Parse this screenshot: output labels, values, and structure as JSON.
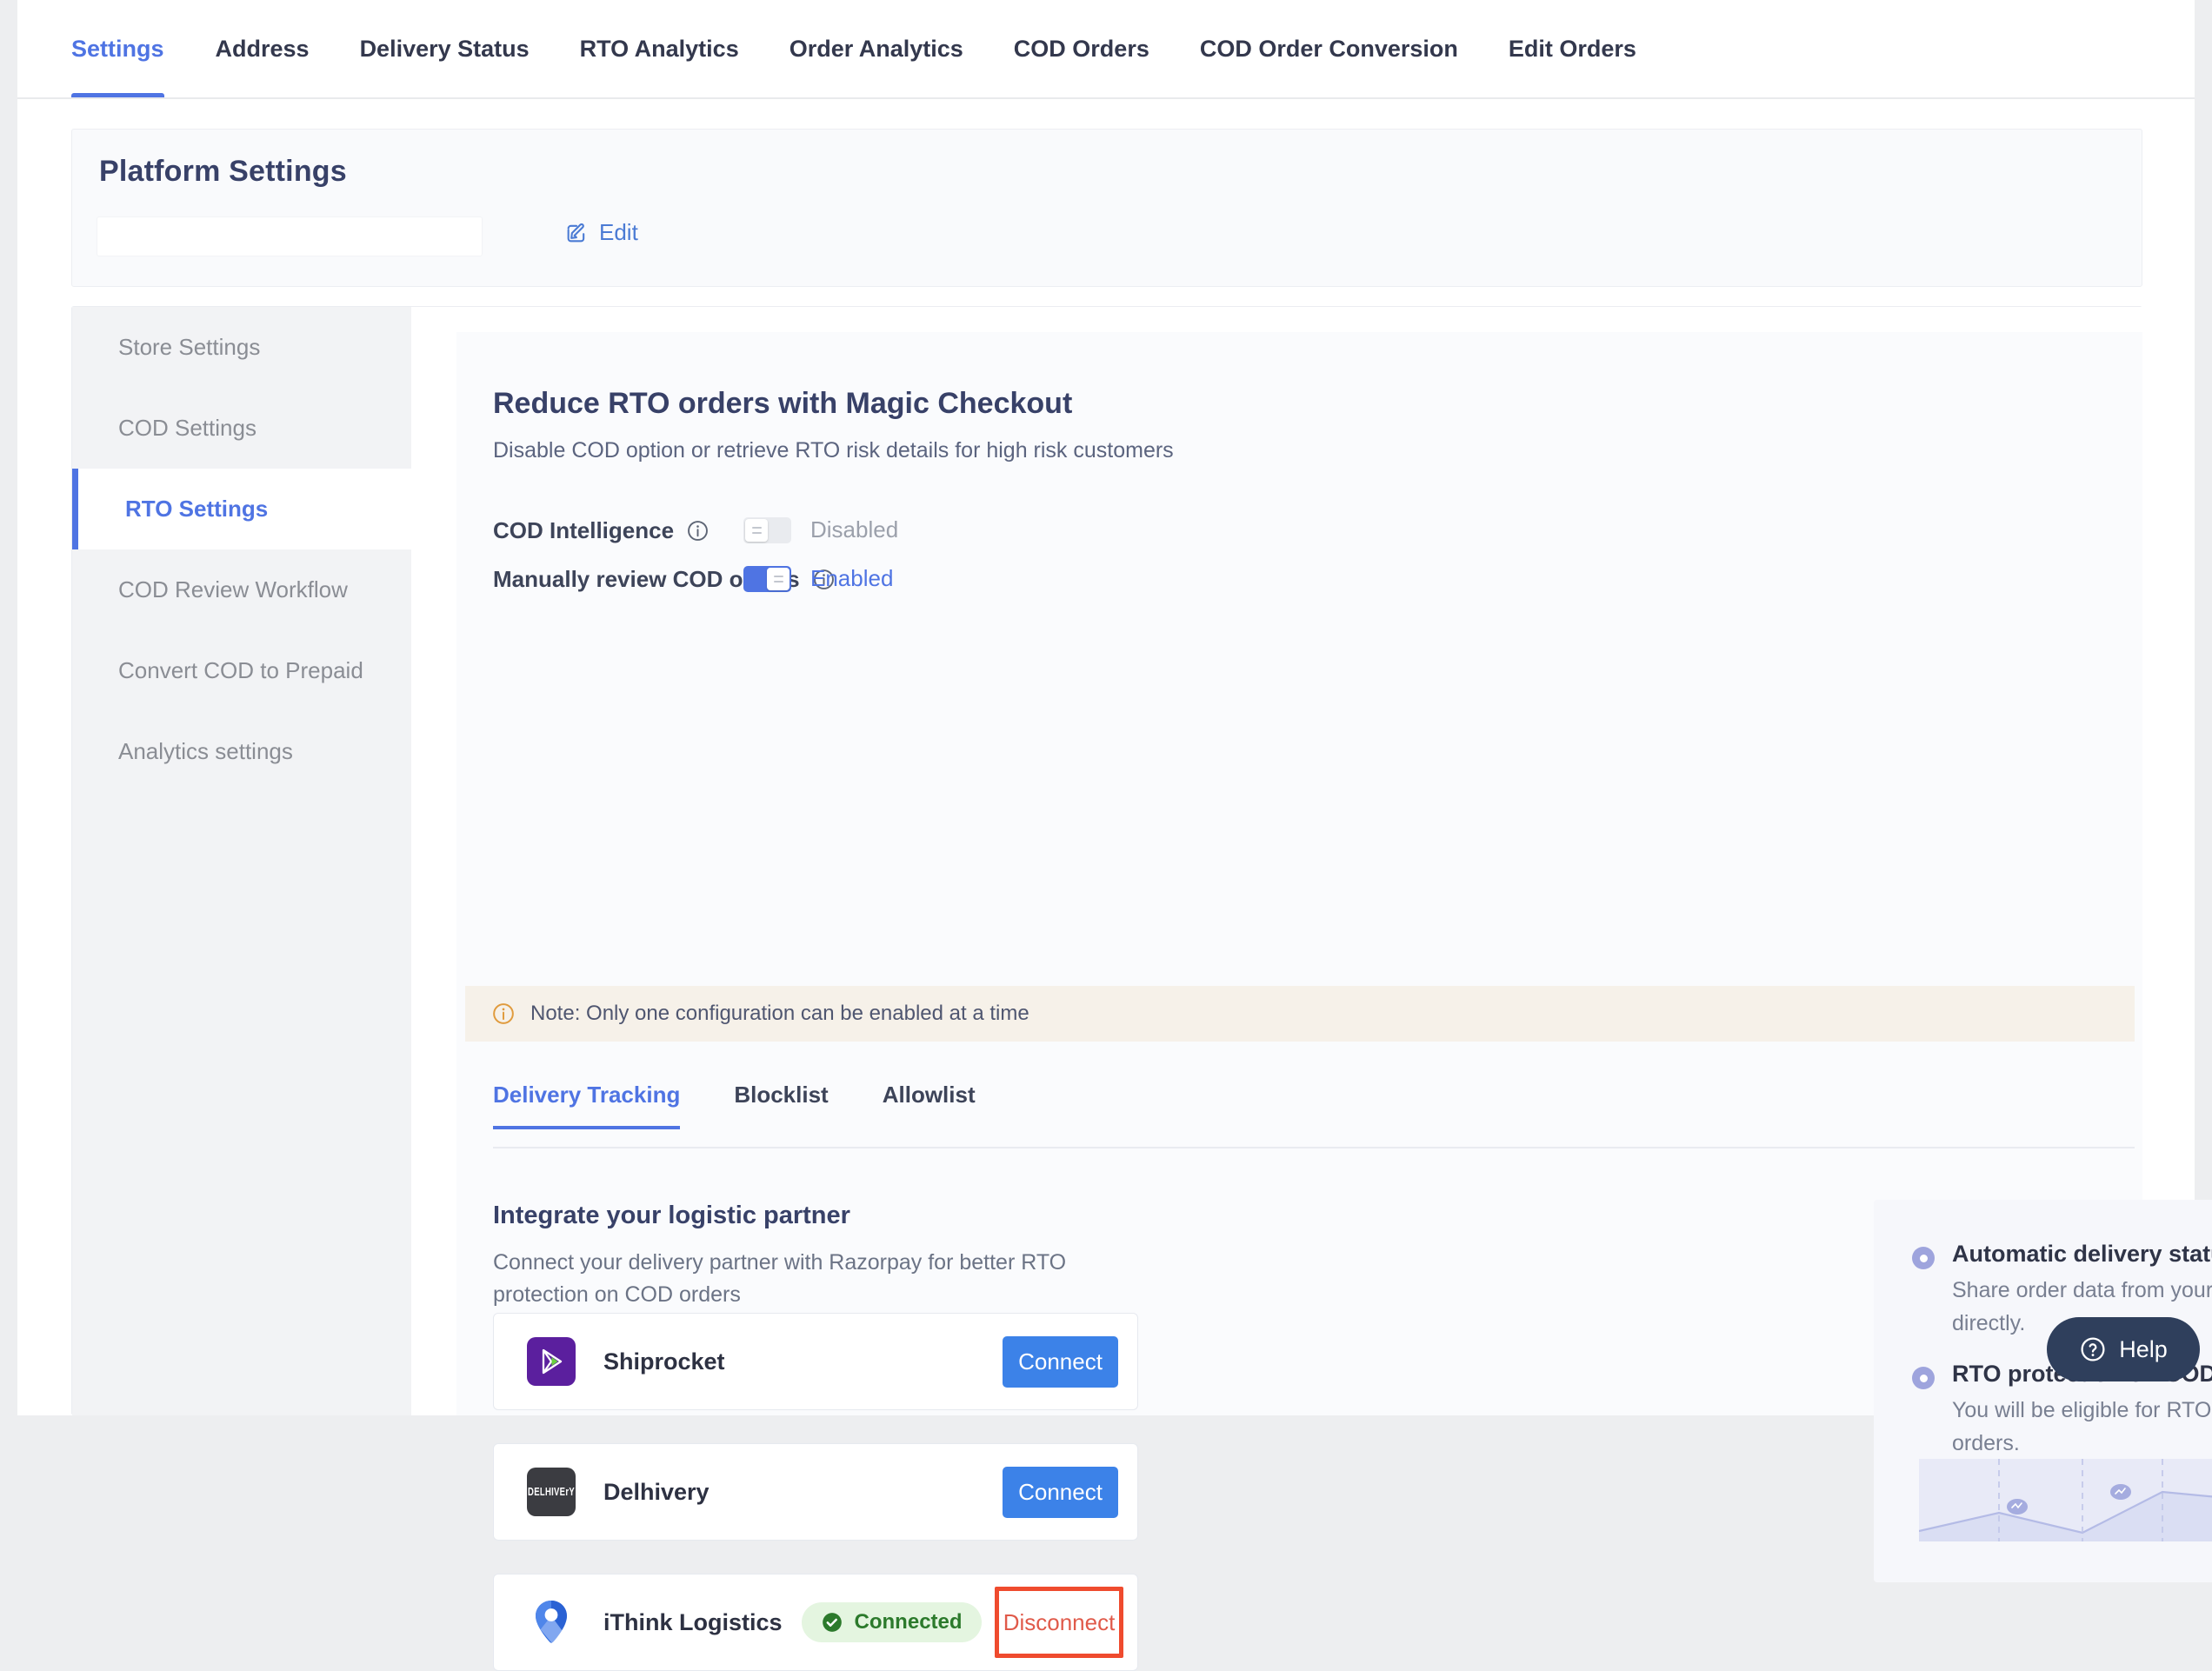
{
  "topnav": {
    "items": [
      {
        "label": "Settings",
        "active": true
      },
      {
        "label": "Address",
        "active": false
      },
      {
        "label": "Delivery Status",
        "active": false
      },
      {
        "label": "RTO Analytics",
        "active": false
      },
      {
        "label": "Order Analytics",
        "active": false
      },
      {
        "label": "COD Orders",
        "active": false
      },
      {
        "label": "COD Order Conversion",
        "active": false
      },
      {
        "label": "Edit Orders",
        "active": false
      }
    ]
  },
  "platform_settings": {
    "title": "Platform Settings",
    "input_value": "",
    "edit_label": "Edit",
    "edit_icon": "pencil-square-icon"
  },
  "sidebar": {
    "items": [
      {
        "label": "Store Settings",
        "active": false
      },
      {
        "label": "COD Settings",
        "active": false
      },
      {
        "label": "RTO Settings",
        "active": true
      },
      {
        "label": "COD Review Workflow",
        "active": false
      },
      {
        "label": "Convert COD to Prepaid",
        "active": false
      },
      {
        "label": "Analytics settings",
        "active": false
      }
    ]
  },
  "main": {
    "section_title": "Reduce RTO orders with Magic Checkout",
    "section_subtitle": "Disable COD option or retrieve RTO risk details for high risk customers",
    "settings_rows": [
      {
        "label": "COD Intelligence",
        "info_icon": "info-circle-icon",
        "state": "Disabled",
        "enabled": false
      },
      {
        "label": "Manually review COD orders",
        "info_icon": "info-circle-icon",
        "state": "Enabled",
        "enabled": true
      }
    ],
    "note": {
      "icon": "info-circle-icon",
      "text": "Note: Only one configuration can be enabled at a time"
    },
    "tabs": [
      {
        "label": "Delivery Tracking",
        "active": true
      },
      {
        "label": "Blocklist",
        "active": false
      },
      {
        "label": "Allowlist",
        "active": false
      }
    ],
    "integrate": {
      "title": "Integrate your logistic partner",
      "subtitle": "Connect your delivery partner with Razorpay for better RTO protection on COD orders"
    },
    "partners": [
      {
        "name": "Shiprocket",
        "logo": "shiprocket-logo-icon",
        "status": null,
        "action_label": "Connect",
        "action_type": "connect"
      },
      {
        "name": "Delhivery",
        "logo": "delhivery-logo-icon",
        "logo_text": "DELHIVErY",
        "status": null,
        "action_label": "Connect",
        "action_type": "connect"
      },
      {
        "name": "iThink Logistics",
        "logo": "ithink-logistics-map-pin-icon",
        "status": "Connected",
        "status_icon": "check-circle-icon",
        "action_label": "Disconnect",
        "action_type": "disconnect"
      }
    ]
  },
  "info_panel": {
    "items": [
      {
        "heading": "Automatic delivery status updates",
        "body": "Share order data from your logistic partner account directly."
      },
      {
        "heading": "RTO protection on COD orders",
        "body": "You will be eligible for RTO protection on these orders."
      }
    ],
    "illustration": "area-chart-placeholder-illustration"
  },
  "help": {
    "label": "Help",
    "icon": "question-circle-icon"
  },
  "colors": {
    "accent_blue": "#4f74e3",
    "button_blue": "#3c82e8",
    "success_green": "#2c7a2c",
    "danger_red": "#e05a4a",
    "highlight_red": "#ef4b2e",
    "note_bg": "#f6f1e9",
    "bullet_purple": "#9ea4dd"
  }
}
